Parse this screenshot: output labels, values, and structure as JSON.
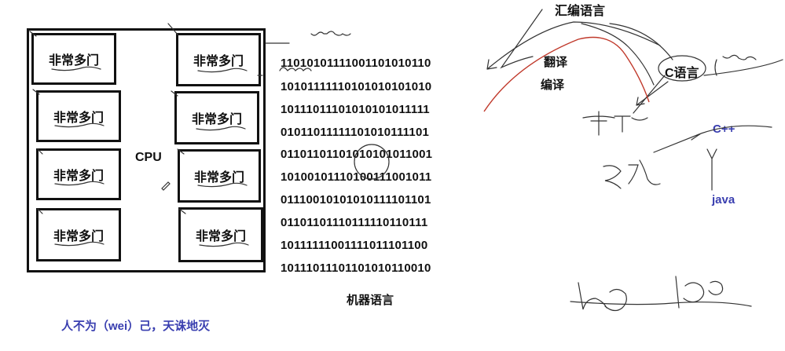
{
  "cpu_label": "CPU",
  "cells": [
    "非常多门",
    "非常多门",
    "非常多门",
    "非常多门",
    "非常多门",
    "非常多门",
    "非常多门",
    "非常多门"
  ],
  "binary_rows": [
    "11010101111001101010110",
    "10101111110101010101010",
    "10111011101010101011111",
    "01011011111101010111101",
    "01101101101010101011001",
    "10100101110100111001011",
    "01110010101010111101101",
    "01101101110111110110111",
    "10111111001111011101100",
    "10111011101101010110010"
  ],
  "labels": {
    "machine_language": "机器语言",
    "assembly": "汇编语言",
    "translate": "翻译",
    "compile": "编译",
    "c_language": "C语言",
    "cpp": "C++",
    "java": "java",
    "motto": "人不为（wei）己，天诛地灭"
  }
}
